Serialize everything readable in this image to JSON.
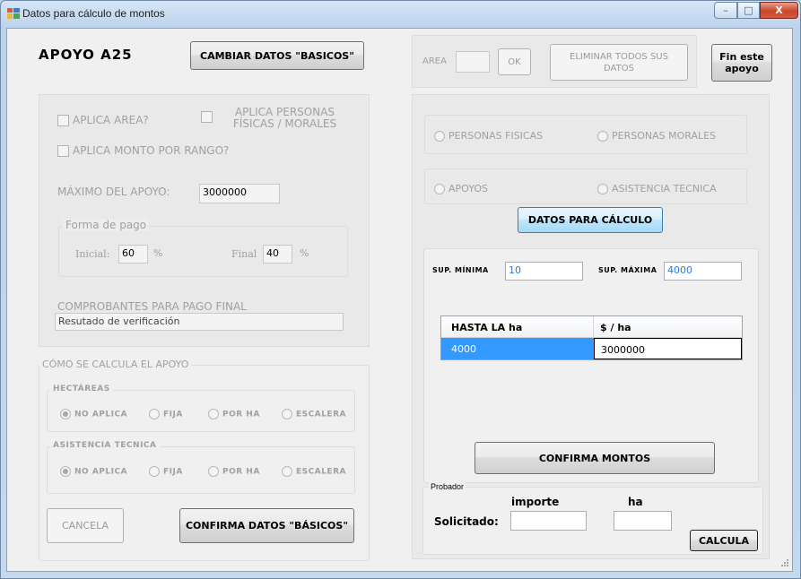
{
  "window": {
    "title": "Datos para cálculo de montos",
    "min_glyph": "–",
    "max_glyph": "□",
    "close_glyph": "X"
  },
  "header": {
    "apoyo_label": "APOYO A25",
    "cambiar_btn": "CAMBIAR DATOS \"BASICOS\"",
    "area_label": "AREA",
    "area_value": "",
    "ok_btn": "OK",
    "eliminar_btn": "ELIMINAR TODOS SUS DATOS",
    "fin_btn": "Fin este apoyo"
  },
  "basicos": {
    "aplica_area": "APLICA AREA?",
    "aplica_personas": "APLICA PERSONAS FÍSICAS / MORALES",
    "aplica_monto_rango": "APLICA MONTO POR RANGO?",
    "maximo_label": "MÁXIMO DEL APOYO:",
    "maximo_value": "3000000",
    "forma_pago_legend": "Forma de pago",
    "inicial_label": "Inicial:",
    "inicial_value": "60",
    "final_label": "Final",
    "final_value": "40",
    "percent": "%",
    "comprobantes_label": "COMPROBANTES PARA PAGO FINAL",
    "comprobantes_value": "Resutado de verificación"
  },
  "calculo": {
    "legend": "CÓMO SE CALCULA EL APOYO",
    "hectareas_legend": "HECTÁREAS",
    "asistencia_legend": "ASISTENCIA TECNICA",
    "options": [
      "NO APLICA",
      "FIJA",
      "POR HA",
      "ESCALERA"
    ],
    "cancela_btn": "CANCELA",
    "confirma_btn": "CONFIRMA DATOS \"BÁSICOS\""
  },
  "right": {
    "personas_fisicas": "PERSONAS FISICAS",
    "personas_morales": "PERSONAS MORALES",
    "apoyos": "APOYOS",
    "asistencia_tecnica": "ASISTENCIA TECNICA",
    "datos_calculo_btn": "DATOS PARA CÁLCULO",
    "sup_minima_label": "SUP. MÍNIMA",
    "sup_minima_value": "10",
    "sup_maxima_label": "SUP. MÁXIMA",
    "sup_maxima_value": "4000",
    "grid_headers": [
      "HASTA LA ha",
      "$ / ha"
    ],
    "grid_rows": [
      [
        "4000",
        "3000000"
      ]
    ],
    "confirma_montos_btn": "CONFIRMA MONTOS"
  },
  "probador": {
    "legend": "Probador",
    "importe_label": "importe",
    "ha_label": "ha",
    "solicitado_label": "Solicitado:",
    "importe_value": "",
    "ha_value": "",
    "calcula_btn": "CALCULA"
  },
  "colors": {
    "selected_row": "#3399ff",
    "value_blue": "#2a7bd6"
  }
}
